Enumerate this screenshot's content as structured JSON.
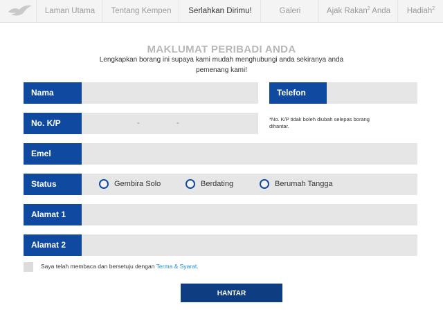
{
  "nav": {
    "items": [
      {
        "label": "Laman Utama"
      },
      {
        "label": "Tentang Kempen"
      },
      {
        "label": "Serlahkan Dirimu!"
      },
      {
        "label": "Galeri"
      },
      {
        "label": "Ajak Rakan",
        "sup": "2",
        "suffix": " Anda"
      },
      {
        "label": "Hadiah",
        "sup": "2"
      }
    ],
    "active": "Serlahkan Dirimu!"
  },
  "form": {
    "title": "MAKLUMAT PERIBADI ANDA",
    "subtitle": "Lengkapkan borang ini supaya kami mudah menghubungi anda sekiranya anda pemenang kami!",
    "fields": {
      "nama": {
        "label": "Nama",
        "value": ""
      },
      "telefon": {
        "label": "Telefon",
        "value": ""
      },
      "nokp": {
        "label": "No. K/P",
        "part1": "",
        "part2": "",
        "part3": "",
        "separator": "-"
      },
      "emel": {
        "label": "Emel",
        "value": ""
      },
      "status": {
        "label": "Status",
        "options": [
          "Gembira Solo",
          "Berdating",
          "Berumah Tangga"
        ],
        "selected": null
      },
      "alamat1": {
        "label": "Alamat 1",
        "value": ""
      },
      "alamat2": {
        "label": "Alamat 2",
        "value": ""
      }
    },
    "note": "*No. K/P tidak boleh diubah selepas borang dihantar.",
    "terms": {
      "text": "Saya telah membaca dan bersetuju dengan ",
      "link": "Terma & Syarat.",
      "checked": false
    },
    "submit_label": "HANTAR"
  },
  "colors": {
    "label_bg": "#0f4aa0",
    "field_bg": "#e6e6e6",
    "submit_bg": "#0f3d82",
    "link": "#1a8fd6",
    "title": "#b7b7b7"
  }
}
